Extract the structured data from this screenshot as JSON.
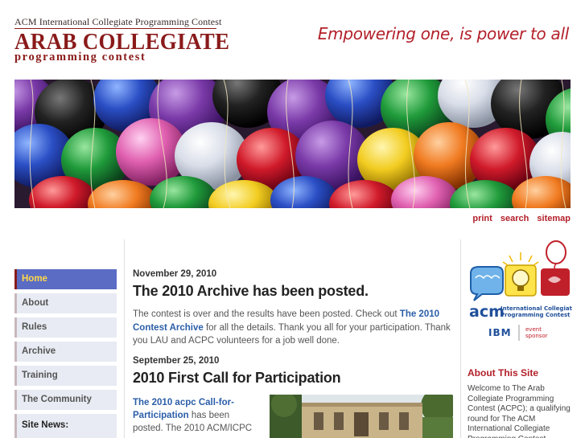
{
  "header": {
    "logo_top": "ACM International Collegiate Programming Contest",
    "logo_main": "ARAB COLLEGIATE",
    "logo_sub": "programming contest",
    "tagline": "Empowering one, is power to all"
  },
  "utility_nav": [
    "print",
    "search",
    "sitemap"
  ],
  "sidebar": {
    "items": [
      {
        "label": "Home",
        "active": true
      },
      {
        "label": "About",
        "active": false
      },
      {
        "label": "Rules",
        "active": false
      },
      {
        "label": "Archive",
        "active": false
      },
      {
        "label": "Training",
        "active": false
      },
      {
        "label": "The Community",
        "active": false
      }
    ],
    "news_label": "Site News:"
  },
  "posts": [
    {
      "date": "November 29, 2010",
      "title": "The 2010 Archive has been posted.",
      "body_pre": "The contest is over and the results have been posted. Check out ",
      "body_link": "The 2010 Contest Archive",
      "body_post": " for all the details. Thank you all for your participation. Thank you LAU and ACPC volunteers for a job well done."
    },
    {
      "date": "September 25, 2010",
      "title": "2010 First Call for Participation",
      "body_link": "The 2010 acpc Call-for-Participation",
      "body_post": " has been posted. The 2010 ACM/ICPC"
    }
  ],
  "right_sidebar": {
    "partner": {
      "acm_text": "acm",
      "acm_sub1": "International Collegiate",
      "acm_sub2": "Programming Contest",
      "sponsor_name": "IBM",
      "sponsor_label1": "event",
      "sponsor_label2": "sponsor"
    },
    "about_title": "About This Site",
    "about_text": "Welcome to The Arab Collegiate Programming Contest (ACPC); a qualifying round for The ACM International Collegiate Programming Contest"
  },
  "colors": {
    "brand": "#8a1a1a",
    "accent_red": "#b3202a",
    "link_blue": "#2b5ea8",
    "nav_active": "#5a6cc4",
    "nav_active_text": "#ffd94a"
  }
}
